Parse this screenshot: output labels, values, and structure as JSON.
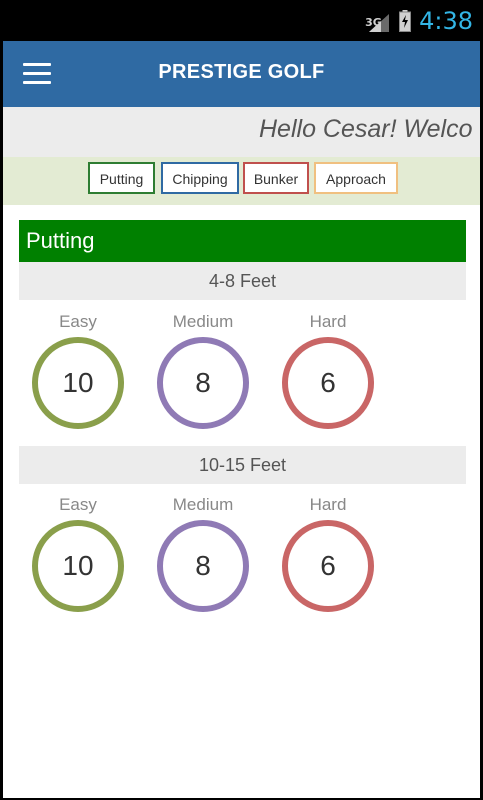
{
  "status_bar": {
    "network": "3G",
    "time": "4:38"
  },
  "app_bar": {
    "title": "PRESTIGE GOLF",
    "menu_icon": "hamburger-menu-icon"
  },
  "welcome": {
    "text": "Hello Cesar! Welco"
  },
  "tabs": [
    {
      "label": "Putting",
      "color": "#2e7d32"
    },
    {
      "label": "Chipping",
      "color": "#2f6aa3"
    },
    {
      "label": "Bunker",
      "color": "#c0504d"
    },
    {
      "label": "Approach",
      "color": "#f0c080"
    }
  ],
  "section": {
    "title": "Putting",
    "color": "#008000"
  },
  "ranges": [
    {
      "label": "4-8 Feet",
      "levels": [
        {
          "label": "Easy",
          "value": "10",
          "color": "#8a9f4b"
        },
        {
          "label": "Medium",
          "value": "8",
          "color": "#8f7ab5"
        },
        {
          "label": "Hard",
          "value": "6",
          "color": "#c96666"
        }
      ]
    },
    {
      "label": "10-15 Feet",
      "levels": [
        {
          "label": "Easy",
          "value": "10",
          "color": "#8a9f4b"
        },
        {
          "label": "Medium",
          "value": "8",
          "color": "#8f7ab5"
        },
        {
          "label": "Hard",
          "value": "6",
          "color": "#c96666"
        }
      ]
    }
  ]
}
